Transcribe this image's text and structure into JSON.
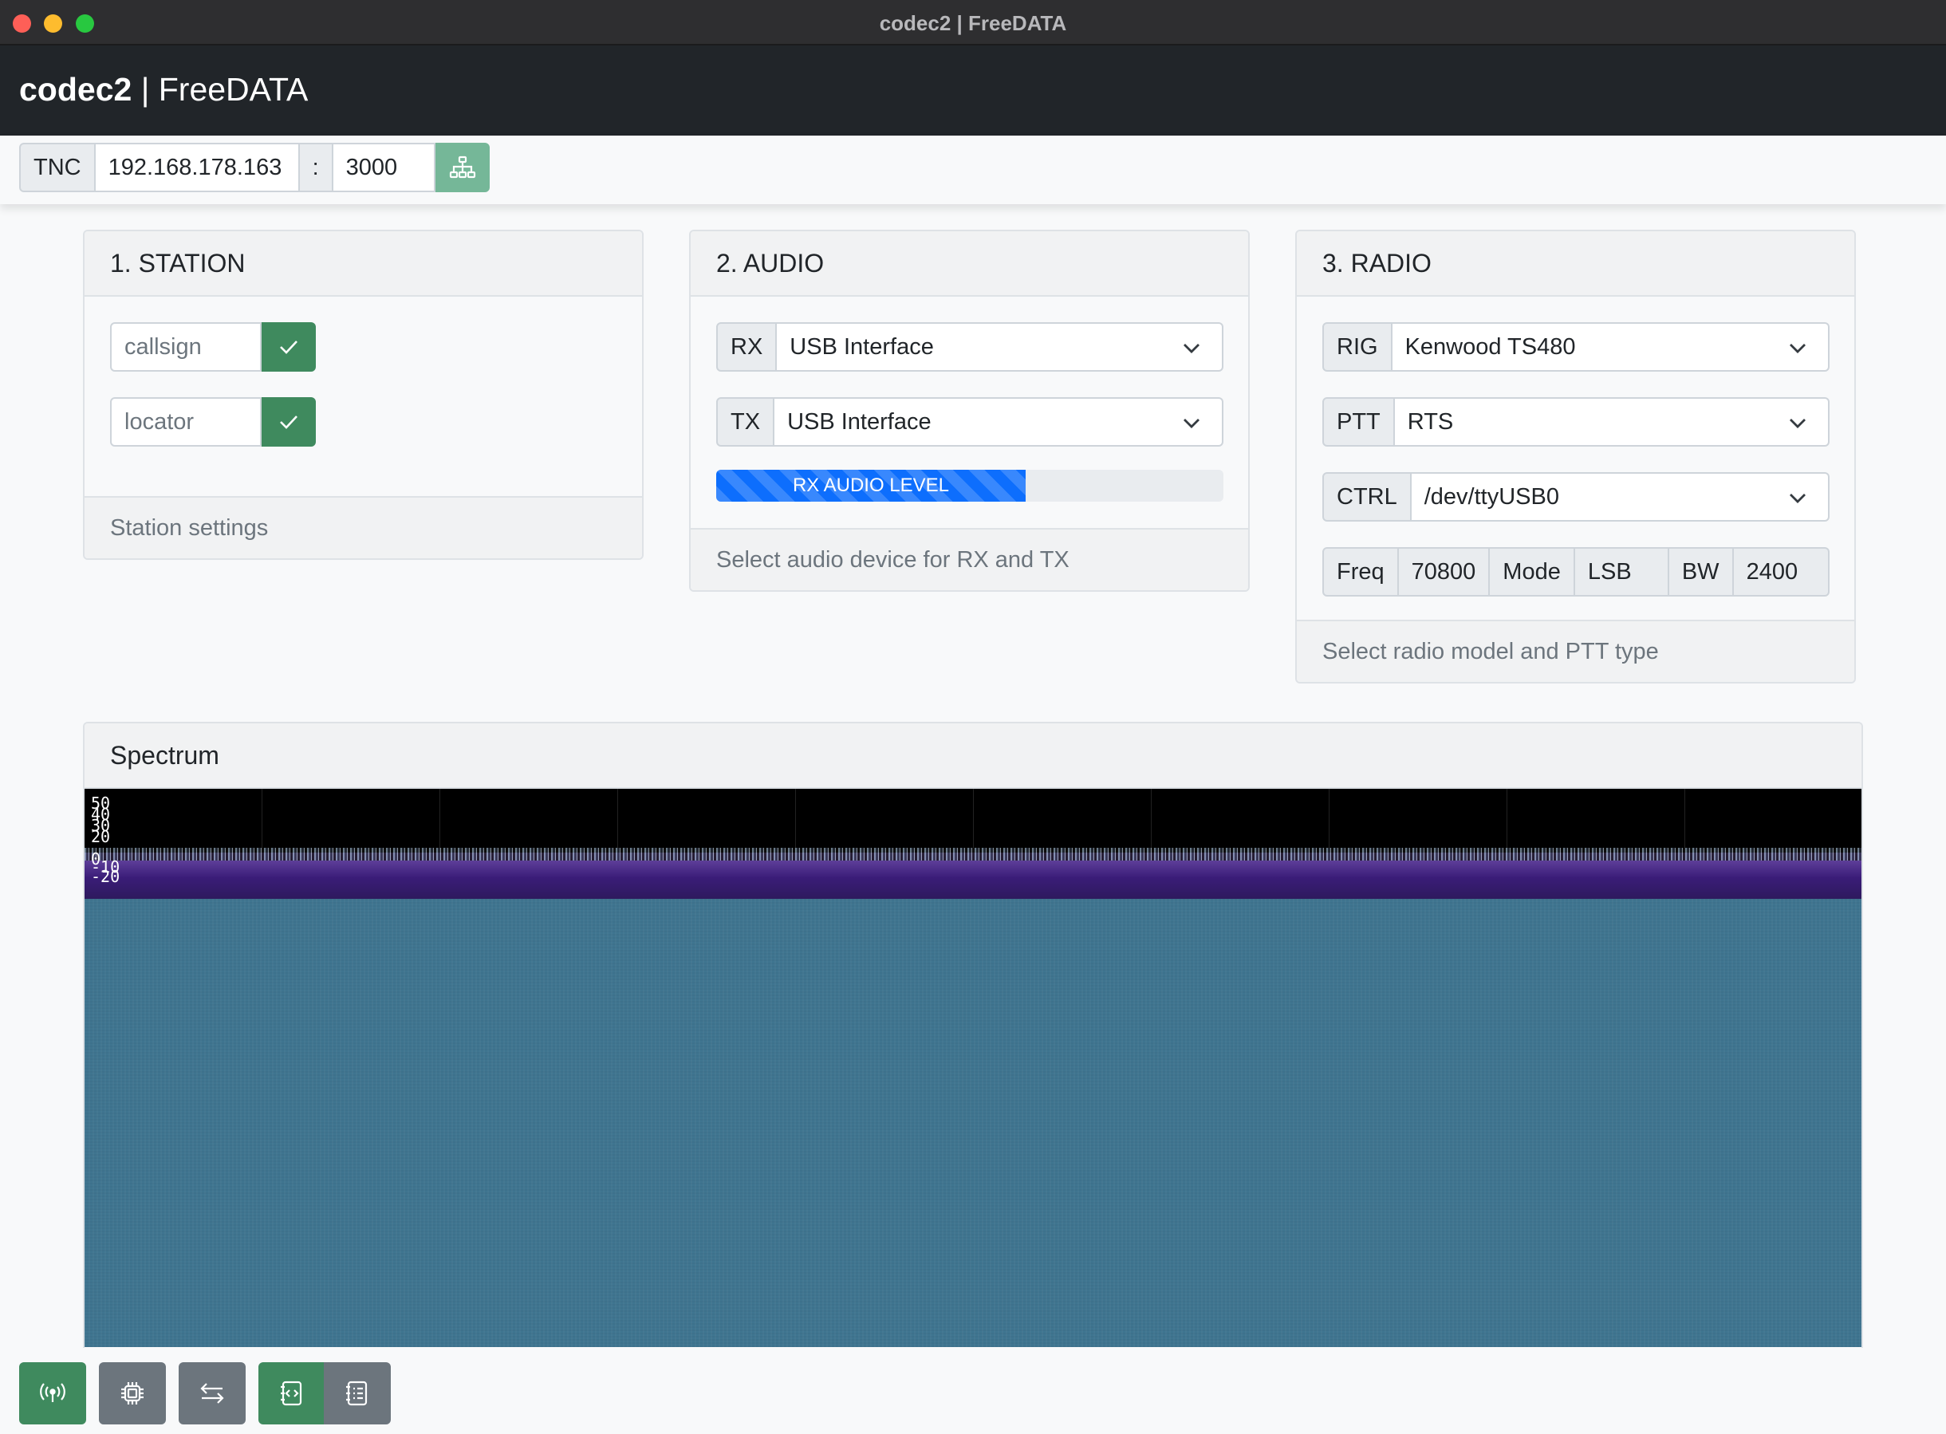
{
  "window": {
    "title": "codec2 | FreeDATA"
  },
  "navbar": {
    "brand_bold": "codec2",
    "brand_rest": " | FreeDATA"
  },
  "tnc": {
    "label": "TNC",
    "ip": "192.168.178.163",
    "separator": ":",
    "port": "3000"
  },
  "station": {
    "title": "1. STATION",
    "callsign_placeholder": "callsign",
    "locator_placeholder": "locator",
    "footer": "Station settings"
  },
  "audio": {
    "title": "2. AUDIO",
    "rx_label": "RX",
    "rx_value": "USB Interface",
    "tx_label": "TX",
    "tx_value": "USB Interface",
    "level_label": "RX AUDIO LEVEL",
    "level_fraction": 0.61,
    "footer": "Select audio device for RX and TX"
  },
  "radio": {
    "title": "3. RADIO",
    "rig_label": "RIG",
    "rig_value": "Kenwood TS480",
    "ptt_label": "PTT",
    "ptt_value": "RTS",
    "ctrl_label": "CTRL",
    "ctrl_value": "/dev/ttyUSB0",
    "freq_label": "Freq",
    "freq_value": "70800",
    "mode_label": "Mode",
    "mode_value": "LSB",
    "bw_label": "BW",
    "bw_value": "2400",
    "footer": "Select radio model and PTT type"
  },
  "spectrum": {
    "title": "Spectrum",
    "y_ticks": [
      "50",
      "40",
      "30",
      "20",
      "0",
      "-10",
      "-20"
    ]
  },
  "icons": {
    "tnc_connect": "network-icon",
    "check": "check-icon",
    "chevron": "chevron-down-icon",
    "footer": [
      "broadcast-icon",
      "cpu-icon",
      "arrows-exchange-icon",
      "code-file-icon",
      "list-file-icon"
    ]
  },
  "colors": {
    "success": "#3f8a5e",
    "success_light": "#75b798",
    "primary": "#0d6efd",
    "secondary": "#6c757d",
    "dark": "#212529"
  }
}
